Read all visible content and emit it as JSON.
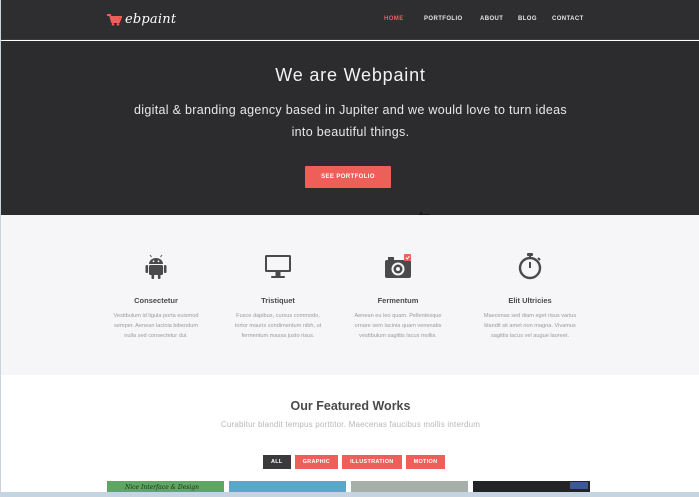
{
  "header": {
    "logo_text": "ebpaint",
    "nav": [
      "HOME",
      "PORTFOLIO",
      "ABOUT",
      "BLOG",
      "CONTACT"
    ],
    "active_nav": "HOME"
  },
  "hero": {
    "title": "We are Webpaint",
    "subtitle_line1": "digital & branding agency based in Jupiter and we would love to turn ideas",
    "subtitle_line2": "into beautiful things.",
    "button": "SEE PORTFOLIO"
  },
  "features": [
    {
      "icon": "android-icon",
      "title": "Consectetur",
      "desc1": "Vestibulum id ligula porta euismod",
      "desc2": "semper. Aenean lacinia bibendum",
      "desc3": "nulla sed consectetur dui."
    },
    {
      "icon": "monitor-icon",
      "title": "Tristiquet",
      "desc1": "Fusce dapibus, cursus commodo,",
      "desc2": "tortor mauris condimentum nibh, ut",
      "desc3": "fermentum massa justo risus."
    },
    {
      "icon": "camera-icon",
      "title": "Fermentum",
      "desc1": "Aenean eu leo quam. Pellentesque",
      "desc2": "ornare sem lacinia quam venenatis",
      "desc3": "vestibulum sagittis lacus mollis."
    },
    {
      "icon": "stopwatch-icon",
      "title": "Elit Ultricies",
      "desc1": "Maecenas sed diam eget risus varius",
      "desc2": "blandit sit amet non magna. Vivamus",
      "desc3": "sagittis lacus vel augue laoreet."
    }
  ],
  "works": {
    "title": "Our Featured Works",
    "subtitle": "Curabitur blandit tempus porttitor. Maecenas faucibus mollis interdum",
    "filters": [
      "ALL",
      "GRAPHIC",
      "ILLUSTRATION",
      "MOTION"
    ],
    "active_filter": "ALL",
    "thumb1_text": "Nice Interface & Design"
  },
  "colors": {
    "accent": "#ef5f5a",
    "header_bg": "#2e2d30",
    "hero_bg": "#2c2b2e",
    "features_bg": "#f6f6f8"
  }
}
